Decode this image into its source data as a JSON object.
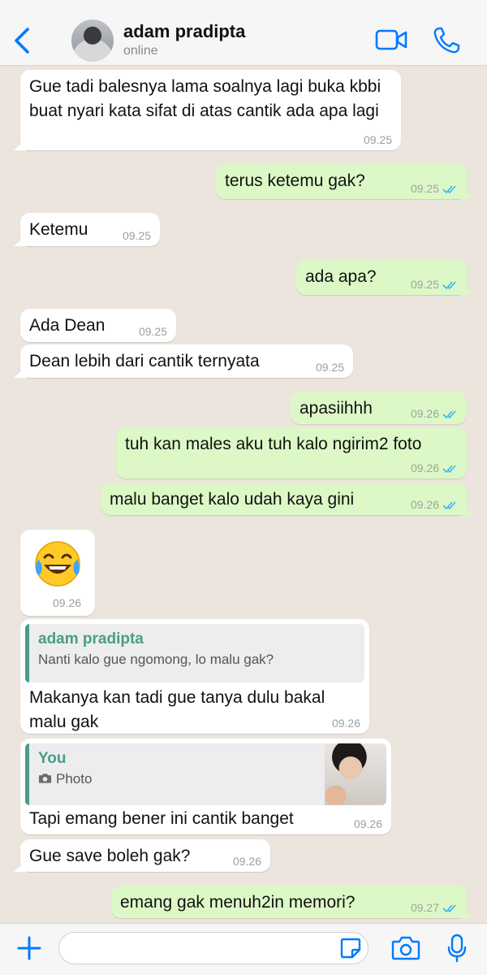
{
  "header": {
    "contact_name": "adam pradipta",
    "status": "online"
  },
  "colors": {
    "accent": "#007AFF",
    "incoming_bubble": "#FFFFFF",
    "outgoing_bubble": "#DCF8C6",
    "chat_background": "#ECE5DD",
    "read_ticks": "#34B7F1",
    "quote_accent": "#4A9C8A"
  },
  "messages": [
    {
      "dir": "in",
      "text": "Gue tadi balesnya lama soalnya lagi buka kbbi buat nyari kata sifat di atas cantik ada apa lagi",
      "time": "09.25"
    },
    {
      "dir": "out",
      "text": "terus ketemu gak?",
      "time": "09.25",
      "status": "read"
    },
    {
      "dir": "in",
      "text": "Ketemu",
      "time": "09.25"
    },
    {
      "dir": "out",
      "text": "ada apa?",
      "time": "09.25",
      "status": "read"
    },
    {
      "dir": "in",
      "text": "Ada Dean",
      "time": "09.25"
    },
    {
      "dir": "in",
      "text": "Dean lebih dari cantik ternyata",
      "time": "09.25"
    },
    {
      "dir": "out",
      "text": "apasiihhh",
      "time": "09.26",
      "status": "read"
    },
    {
      "dir": "out",
      "text": "tuh kan males aku tuh kalo ngirim2 foto",
      "time": "09.26",
      "status": "read"
    },
    {
      "dir": "out",
      "text": "malu banget kalo udah kaya gini",
      "time": "09.26",
      "status": "read"
    },
    {
      "dir": "in",
      "emoji": "face-with-tears-of-joy-icon",
      "time": "09.26"
    },
    {
      "dir": "in",
      "quote_name": "adam pradipta",
      "quote_text": "Nanti kalo gue ngomong, lo malu gak?",
      "text": "Makanya kan tadi gue tanya dulu bakal malu gak",
      "time": "09.26"
    },
    {
      "dir": "in",
      "quote_name": "You",
      "quote_text": "Photo",
      "quote_icon": "camera-icon",
      "text": "Tapi emang bener ini cantik banget",
      "time": "09.26"
    },
    {
      "dir": "in",
      "text": "Gue save boleh gak?",
      "time": "09.26"
    },
    {
      "dir": "out",
      "text": "emang gak menuh2in memori?",
      "time": "09.27",
      "status": "read"
    }
  ],
  "composer": {
    "input_value": "",
    "icons": [
      "plus-icon",
      "sticker-icon",
      "camera-icon",
      "microphone-icon"
    ]
  }
}
